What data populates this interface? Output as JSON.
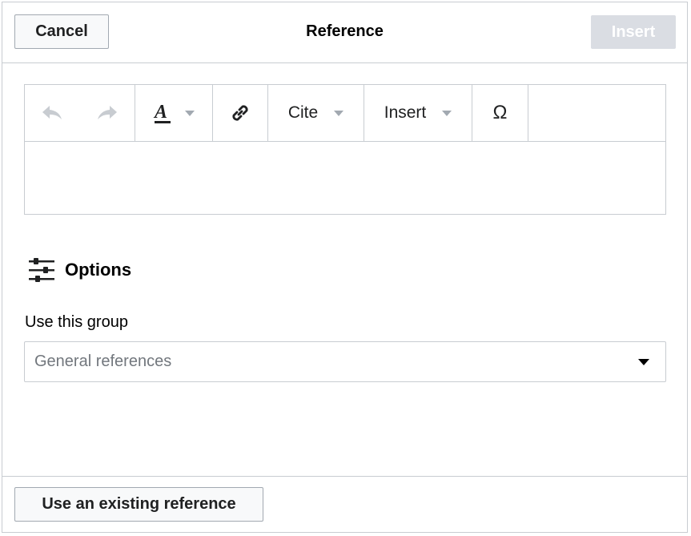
{
  "header": {
    "cancel_label": "Cancel",
    "title": "Reference",
    "insert_label": "Insert"
  },
  "toolbar": {
    "undo_icon": "undo-arrow-icon",
    "redo_icon": "redo-arrow-icon",
    "style_icon": "text-style-A-icon",
    "link_icon": "chain-link-icon",
    "cite_label": "Cite",
    "insert_label": "Insert",
    "special_char_label": "Ω"
  },
  "options": {
    "title": "Options",
    "icon": "sliders-icon",
    "group_label": "Use this group",
    "group_select": {
      "selected": "General references"
    }
  },
  "footer": {
    "existing_label": "Use an existing reference"
  },
  "colors": {
    "border": "#c8ccd1",
    "disabled_button": "#dadde3",
    "icon_disabled": "#c8ccd1",
    "placeholder_text": "#72777d"
  }
}
